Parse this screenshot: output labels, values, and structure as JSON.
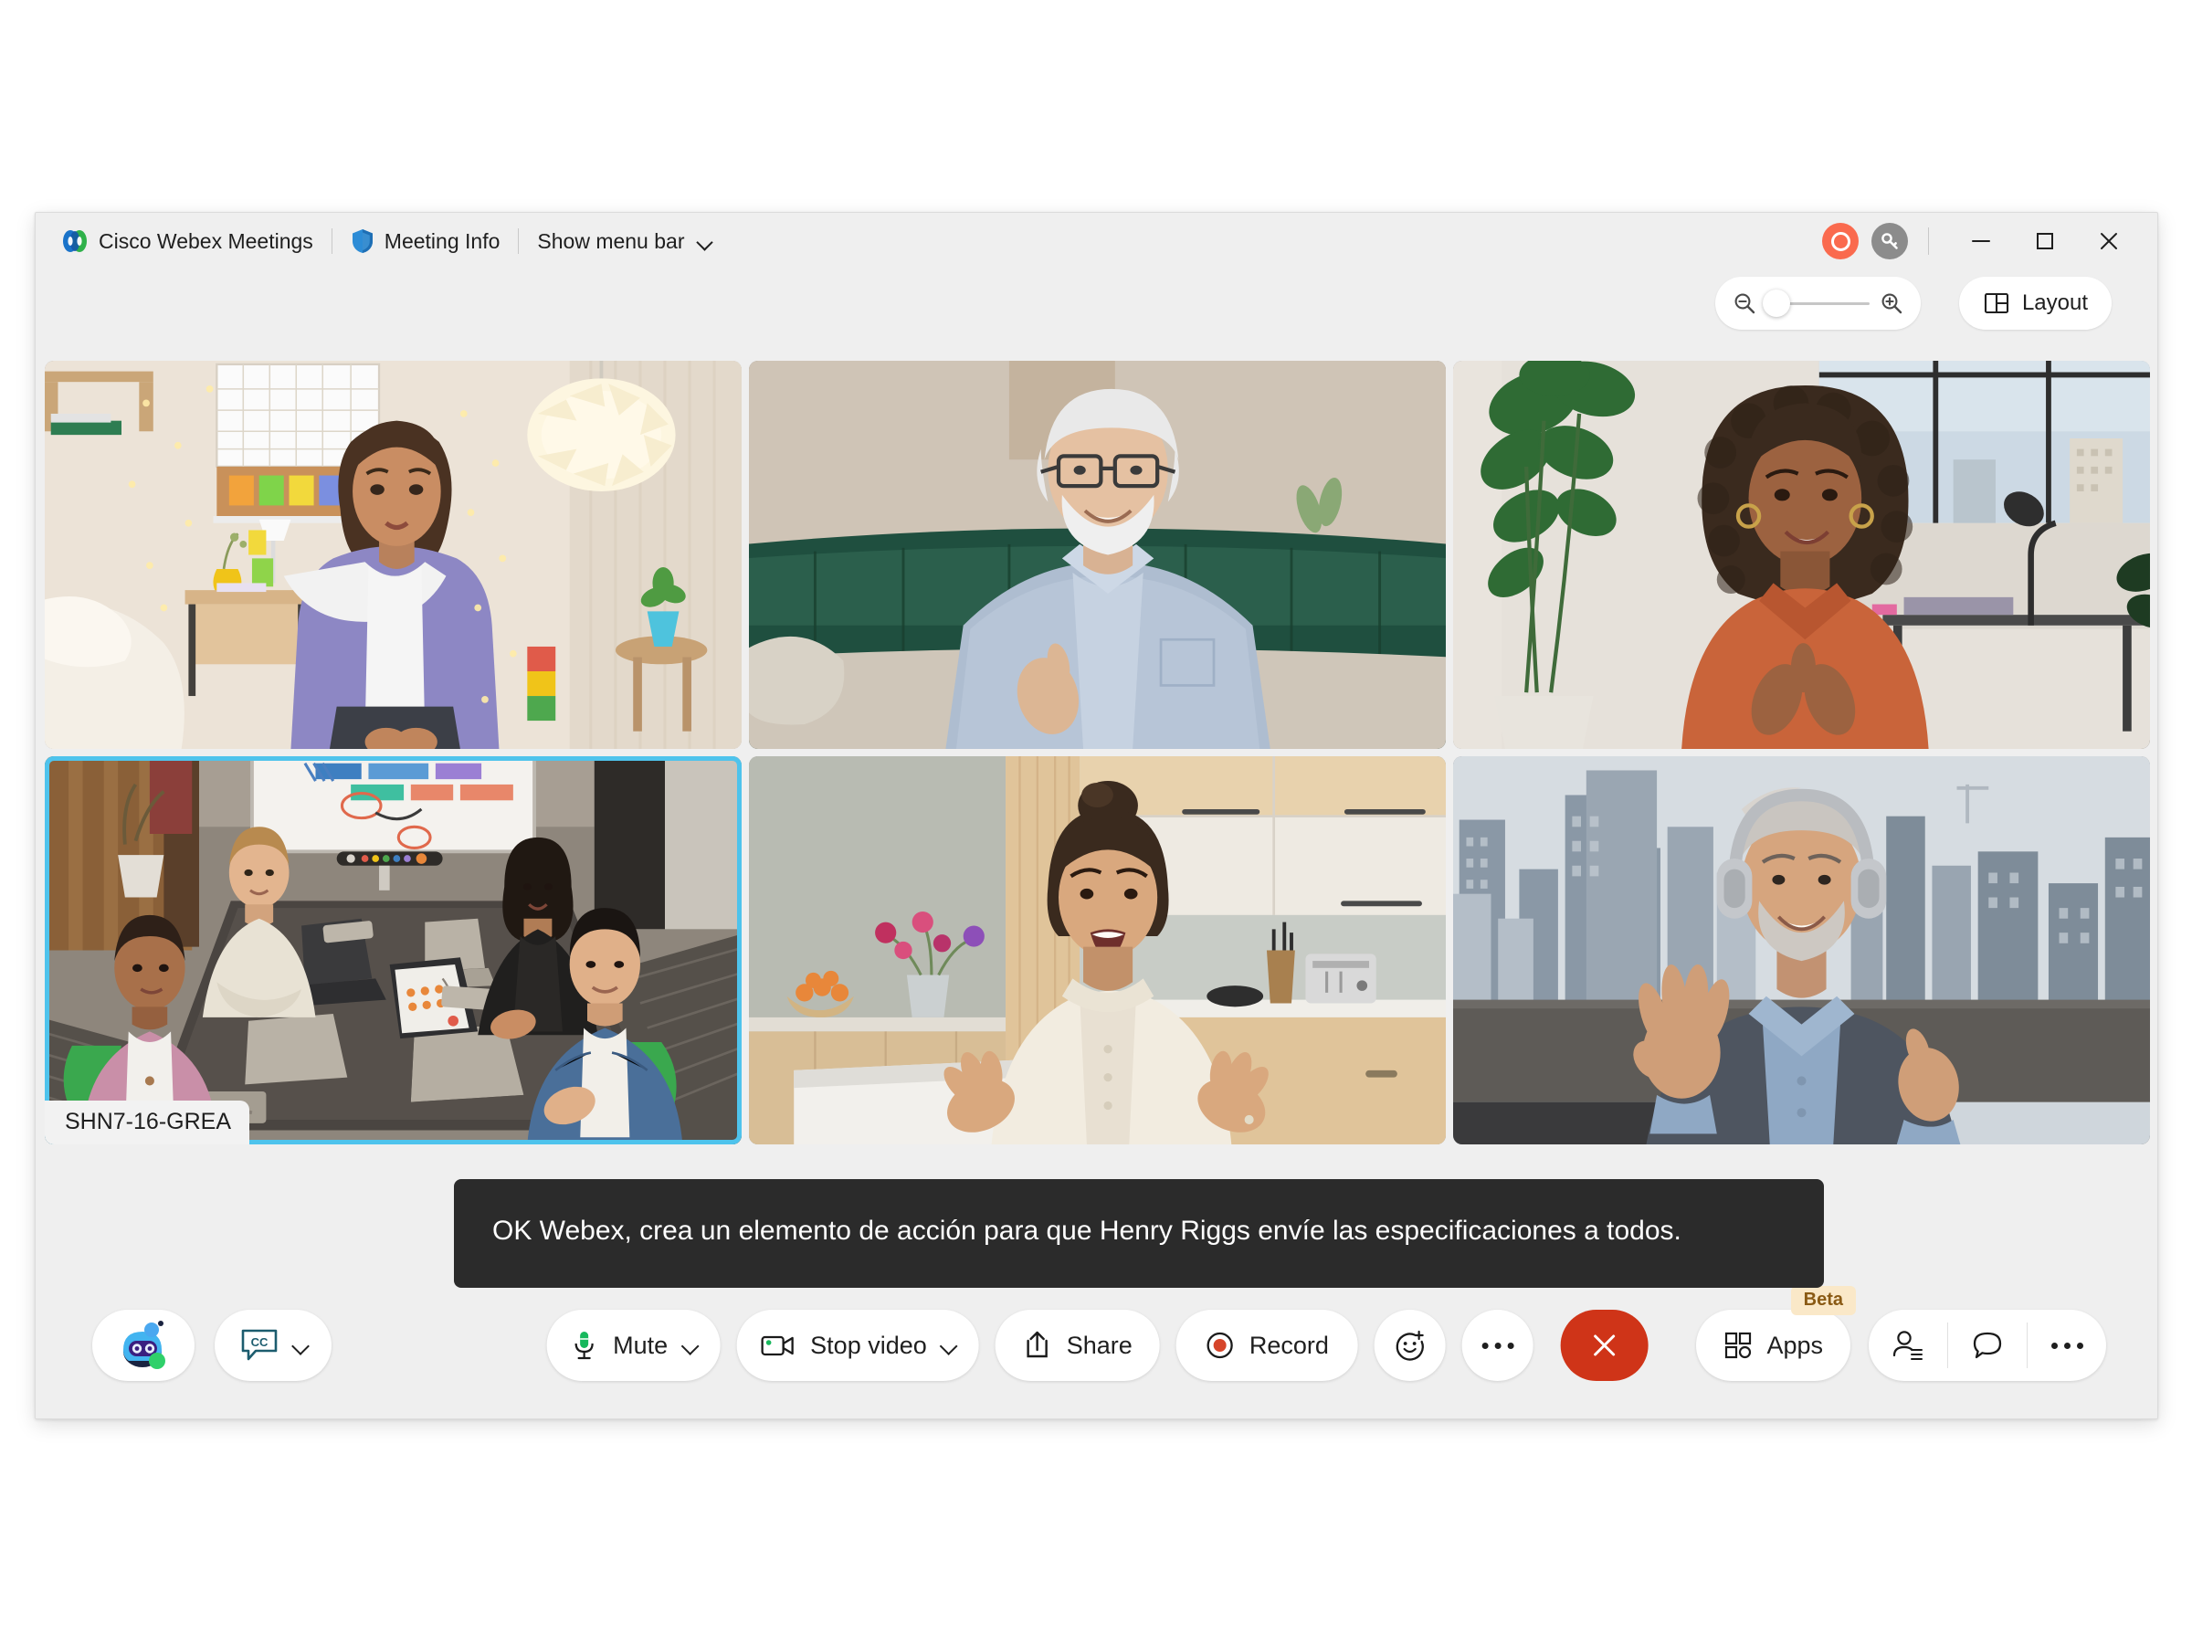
{
  "window": {
    "app_title": "Cisco Webex Meetings",
    "meeting_info_label": "Meeting Info",
    "show_menu_bar_label": "Show menu bar",
    "controls": {
      "recording_indicator": "recording-indicator",
      "encryption_key": "encryption-key-icon",
      "minimize": "minimize",
      "maximize": "maximize",
      "close": "close"
    }
  },
  "toolbar": {
    "zoom_out_icon": "zoom-out-icon",
    "zoom_in_icon": "zoom-in-icon",
    "zoom_level_percent": 0,
    "layout_label": "Layout"
  },
  "grid": {
    "active_speaker_color": "#4ec3ec",
    "tiles": [
      {
        "id": "tile-1",
        "name": "",
        "active": false,
        "scene": "bedroom-woman-purple-shirt"
      },
      {
        "id": "tile-2",
        "name": "",
        "active": false,
        "scene": "livingroom-older-man-glasses"
      },
      {
        "id": "tile-3",
        "name": "",
        "active": false,
        "scene": "office-woman-orange-blouse"
      },
      {
        "id": "tile-4",
        "name": "SHN7-16-GREA",
        "active": true,
        "scene": "conference-room-four-people"
      },
      {
        "id": "tile-5",
        "name": "",
        "active": false,
        "scene": "kitchen-woman-cream-blouse"
      },
      {
        "id": "tile-6",
        "name": "",
        "active": false,
        "scene": "rooftop-man-headphones"
      }
    ]
  },
  "caption": {
    "text": "OK Webex, crea un elemento de acción para que Henry Riggs envíe las especificaciones a todos."
  },
  "controls": {
    "left": {
      "ai_assistant_label": "ai-assistant-avatar",
      "cc_label": "CC"
    },
    "center": {
      "mute_label": "Mute",
      "video_label": "Stop video",
      "share_label": "Share",
      "record_label": "Record",
      "reactions_label": "reactions",
      "more_label": "more-options",
      "leave_label": "leave-meeting"
    },
    "right": {
      "apps_label": "Apps",
      "beta_badge": "Beta",
      "participants_label": "participants",
      "chat_label": "chat",
      "more_label": "more-options"
    }
  }
}
